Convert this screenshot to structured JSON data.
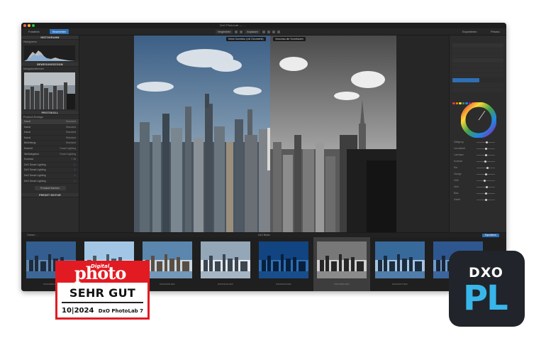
{
  "window": {
    "title": "DxO PhotoLab — ...",
    "traffic_colors": [
      "#ff5f57",
      "#febc2e",
      "#28c840"
    ]
  },
  "toolbar": {
    "tabs": [
      {
        "label": "Fotothek"
      },
      {
        "label": "Bearbeiten"
      }
    ],
    "view_chips": [
      "Vergleichen",
      "Anpassen"
    ],
    "right_tabs": [
      "Exportieren",
      "Prisma"
    ]
  },
  "left_panel": {
    "histogram_title": "HISTOGRAMM",
    "histogram_sub": "Histogramm",
    "navigator_title": "BEWEGUNGSZOOM",
    "navigator_sub": "Navigationsfenster",
    "protocol_title": "PROTOKOLL",
    "protocol_sub": "Protokoll-Einträge",
    "items": [
      {
        "label": "Kanal",
        "value": "Standard"
      },
      {
        "label": "Kanal",
        "value": "Standard"
      },
      {
        "label": "Kanal",
        "value": "Standard"
      },
      {
        "label": "Kanal",
        "value": "Standard"
      },
      {
        "label": "Belichtung",
        "value": "Standard"
      },
      {
        "label": "Klarheit",
        "value": "Smart Lighting"
      },
      {
        "label": "Weißabgleich",
        "value": "Smart Lighting"
      },
      {
        "label": "Kontrast",
        "value": "+ 15"
      },
      {
        "label": "DxO Smart Lighting",
        "value": "✓"
      },
      {
        "label": "DxO Smart Lighting",
        "value": "✓"
      },
      {
        "label": "DxO Smart Lighting",
        "value": "✓"
      },
      {
        "label": "DxO Smart Lighting",
        "value": "✓"
      }
    ],
    "button_label": "Protokoll löschen",
    "preset_title": "PRESET EDITOR"
  },
  "viewer": {
    "label_left": "Keine Korrektur (mit Geometrie)",
    "label_right": "Vorschau der Korrekturen"
  },
  "right_panel": {
    "swatch_colors": [
      "#e53935",
      "#fb8c00",
      "#fdd835",
      "#43a047",
      "#1e88e5",
      "#8e24aa",
      "#ec407a",
      "#00acc1"
    ],
    "labels": [
      "Sättigung",
      "Leuchtkraft",
      "Luminanz",
      "Kontrast",
      "Rot",
      "Orange",
      "Gelb",
      "Grün",
      "Blau",
      "Violett"
    ]
  },
  "filmstrip": {
    "folder_label": "Ordner: ...",
    "center_label": "DxO Bilder",
    "export_button": "Exportieren",
    "thumbs": [
      {
        "caption": "DSCF0093.RAF"
      },
      {
        "caption": "DSCF0101.RAF"
      },
      {
        "caption": "DSCF0105.RAF"
      },
      {
        "caption": "DSCF0129.RAF"
      },
      {
        "caption": "DSCF0134.RAF"
      },
      {
        "caption": "DSCF0084.RAF"
      },
      {
        "caption": "DSCF0157.RAF"
      },
      {
        "caption": "DSCF0161.RAF"
      }
    ]
  },
  "award": {
    "magazine_prefix": "Digital",
    "magazine_name": "photo",
    "rating": "SEHR GUT",
    "issue": "10|2024",
    "product": "DxO PhotoLab 7",
    "brand_color": "#e21b23"
  },
  "logo": {
    "top_text": "DXO",
    "main_text": "PL",
    "bg_color": "#21242a",
    "accent_color": "#38b6ea"
  }
}
